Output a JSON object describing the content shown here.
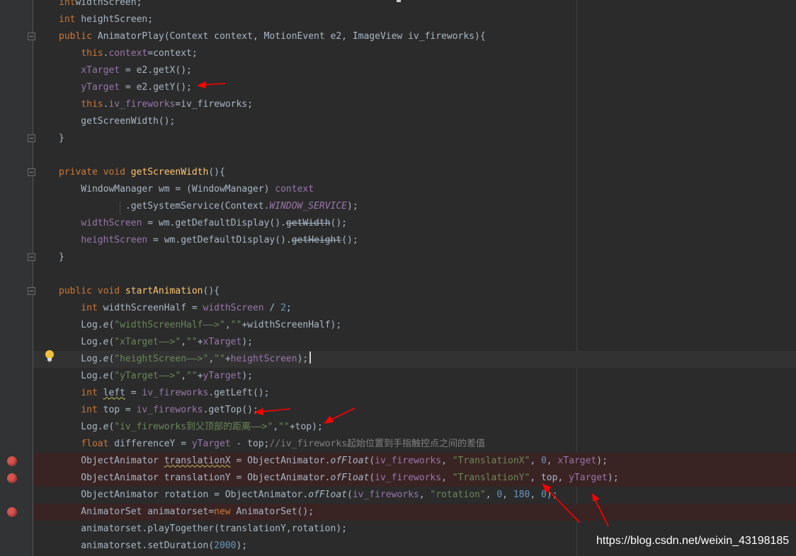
{
  "editor": {
    "lines": [
      {
        "id": "l1",
        "parts": [
          [
            "kw",
            "int"
          ],
          [
            "",
            "widthScreen;"
          ]
        ]
      },
      {
        "id": "l2",
        "parts": [
          [
            "kw",
            "int"
          ],
          [
            "",
            " heightScreen;"
          ]
        ]
      },
      {
        "id": "l3",
        "parts": [
          [
            "kw",
            "public"
          ],
          [
            "",
            " AnimatorPlay(Context context, MotionEvent e2, ImageView iv_fireworks){"
          ]
        ]
      },
      {
        "id": "l4",
        "parts": [
          [
            "",
            "    "
          ],
          [
            "kw",
            "this"
          ],
          [
            "",
            "."
          ],
          [
            "fld",
            "context"
          ],
          [
            "",
            "=context;"
          ]
        ]
      },
      {
        "id": "l5",
        "parts": [
          [
            "",
            "    "
          ],
          [
            "fld",
            "xTarget"
          ],
          [
            "",
            " = e2.getX();"
          ]
        ]
      },
      {
        "id": "l6",
        "parts": [
          [
            "",
            "    "
          ],
          [
            "fld",
            "yTarget"
          ],
          [
            "",
            " = e2.getY();"
          ]
        ]
      },
      {
        "id": "l7",
        "parts": [
          [
            "",
            "    "
          ],
          [
            "kw",
            "this"
          ],
          [
            "",
            "."
          ],
          [
            "fld",
            "iv_fireworks"
          ],
          [
            "",
            "=iv_fireworks;"
          ]
        ]
      },
      {
        "id": "l8",
        "parts": [
          [
            "",
            "    getScreenWidth();"
          ]
        ]
      },
      {
        "id": "l9",
        "parts": [
          [
            "",
            "}"
          ]
        ]
      },
      {
        "id": "l10",
        "parts": [
          [
            "kw",
            "private void"
          ],
          [
            "",
            " "
          ],
          [
            "fn",
            "getScreenWidth"
          ],
          [
            "",
            "(){"
          ]
        ]
      },
      {
        "id": "l11",
        "parts": [
          [
            "",
            "    WindowManager wm = (WindowManager) "
          ],
          [
            "fld",
            "context"
          ]
        ]
      },
      {
        "id": "l12",
        "parts": [
          [
            "",
            "            .getSystemService(Context."
          ],
          [
            "fld sm",
            "WINDOW_SERVICE"
          ],
          [
            "",
            ");"
          ]
        ]
      },
      {
        "id": "l13",
        "parts": [
          [
            "",
            "    "
          ],
          [
            "fld",
            "widthScreen"
          ],
          [
            "",
            " = wm.getDefaultDisplay()."
          ],
          [
            "strike",
            "getWidth"
          ],
          [
            "",
            "();"
          ]
        ]
      },
      {
        "id": "l14",
        "parts": [
          [
            "",
            "    "
          ],
          [
            "fld",
            "heightScreen"
          ],
          [
            "",
            " = wm.getDefaultDisplay()."
          ],
          [
            "strike",
            "getHeight"
          ],
          [
            "",
            "();"
          ]
        ]
      },
      {
        "id": "l15",
        "parts": [
          [
            "",
            "}"
          ]
        ]
      },
      {
        "id": "l16",
        "parts": [
          [
            "kw",
            "public void"
          ],
          [
            "",
            " "
          ],
          [
            "fn",
            "startAnimation"
          ],
          [
            "",
            "(){"
          ]
        ]
      },
      {
        "id": "l17",
        "parts": [
          [
            "",
            "    "
          ],
          [
            "kw",
            "int"
          ],
          [
            "",
            " widthScreenHalf = "
          ],
          [
            "fld",
            "widthScreen"
          ],
          [
            "",
            " / "
          ],
          [
            "num",
            "2"
          ],
          [
            "",
            ";"
          ]
        ]
      },
      {
        "id": "l18",
        "parts": [
          [
            "",
            "    Log."
          ],
          [
            "sm",
            "e"
          ],
          [
            "",
            "("
          ],
          [
            "str",
            "\"widthScreenHalf——>\""
          ],
          [
            "",
            ","
          ],
          [
            "str",
            "\"\""
          ],
          [
            "",
            "+widthScreenHalf);"
          ]
        ]
      },
      {
        "id": "l19",
        "parts": [
          [
            "",
            "    Log."
          ],
          [
            "sm",
            "e"
          ],
          [
            "",
            "("
          ],
          [
            "str",
            "\"xTarget——>\""
          ],
          [
            "",
            ","
          ],
          [
            "str",
            "\"\""
          ],
          [
            "",
            "+"
          ],
          [
            "fld",
            "xTarget"
          ],
          [
            "",
            ");"
          ]
        ]
      },
      {
        "id": "l20",
        "parts": [
          [
            "",
            "    Log."
          ],
          [
            "sm",
            "e"
          ],
          [
            "",
            "("
          ],
          [
            "str",
            "\"heightScreen——>\""
          ],
          [
            "",
            ","
          ],
          [
            "str",
            "\"\""
          ],
          [
            "",
            "+"
          ],
          [
            "fld",
            "heightScreen"
          ],
          [
            "",
            ");"
          ]
        ]
      },
      {
        "id": "l21",
        "parts": [
          [
            "",
            "    Log."
          ],
          [
            "sm",
            "e"
          ],
          [
            "",
            "("
          ],
          [
            "str",
            "\"yTarget——>\""
          ],
          [
            "",
            ","
          ],
          [
            "str",
            "\"\""
          ],
          [
            "",
            "+"
          ],
          [
            "fld",
            "yTarget"
          ],
          [
            "",
            ");"
          ]
        ]
      },
      {
        "id": "l22",
        "parts": [
          [
            "",
            "    "
          ],
          [
            "kw",
            "int"
          ],
          [
            "",
            " "
          ],
          [
            "warn",
            "left"
          ],
          [
            "",
            " = "
          ],
          [
            "fld",
            "iv_fireworks"
          ],
          [
            "",
            ".getLeft();"
          ]
        ]
      },
      {
        "id": "l23",
        "parts": [
          [
            "",
            "    "
          ],
          [
            "kw",
            "int"
          ],
          [
            "",
            " top = "
          ],
          [
            "fld",
            "iv_fireworks"
          ],
          [
            "",
            ".getTop();"
          ]
        ]
      },
      {
        "id": "l24",
        "parts": [
          [
            "",
            "    Log."
          ],
          [
            "sm",
            "e"
          ],
          [
            "",
            "("
          ],
          [
            "str",
            "\"iv_fireworks到父顶部的距离——>\""
          ],
          [
            "",
            ","
          ],
          [
            "str",
            "\"\""
          ],
          [
            "",
            "+top);"
          ]
        ]
      },
      {
        "id": "l25",
        "parts": [
          [
            "",
            "    "
          ],
          [
            "kw",
            "float"
          ],
          [
            "",
            " differenceY = "
          ],
          [
            "fld",
            "yTarget"
          ],
          [
            "",
            " - top;"
          ],
          [
            "cmt",
            "//iv_fireworks起始位置到手指触控点之间的差值"
          ]
        ]
      },
      {
        "id": "l26",
        "parts": [
          [
            "",
            "    ObjectAnimator "
          ],
          [
            "warn",
            "translationX"
          ],
          [
            "",
            " = ObjectAnimator."
          ],
          [
            "sm",
            "ofFloat"
          ],
          [
            "",
            "("
          ],
          [
            "fld",
            "iv_fireworks"
          ],
          [
            "",
            ", "
          ],
          [
            "str",
            "\"TranslationX\""
          ],
          [
            "",
            ", "
          ],
          [
            "num",
            "0"
          ],
          [
            "",
            ", "
          ],
          [
            "fld",
            "xTarget"
          ],
          [
            "",
            ");"
          ]
        ]
      },
      {
        "id": "l27",
        "parts": [
          [
            "",
            "    ObjectAnimator translationY = ObjectAnimator."
          ],
          [
            "sm",
            "ofFloat"
          ],
          [
            "",
            "("
          ],
          [
            "fld",
            "iv_fireworks"
          ],
          [
            "",
            ", "
          ],
          [
            "str",
            "\"TranslationY\""
          ],
          [
            "",
            ", top, "
          ],
          [
            "fld",
            "yTarget"
          ],
          [
            "",
            ");"
          ]
        ]
      },
      {
        "id": "l28",
        "parts": [
          [
            "",
            "    ObjectAnimator rotation = ObjectAnimator."
          ],
          [
            "sm",
            "ofFloat"
          ],
          [
            "",
            "("
          ],
          [
            "fld",
            "iv_fireworks"
          ],
          [
            "",
            ", "
          ],
          [
            "str",
            "\"rotation\""
          ],
          [
            "",
            ", "
          ],
          [
            "num",
            "0"
          ],
          [
            "",
            ", "
          ],
          [
            "num",
            "180"
          ],
          [
            "",
            ", "
          ],
          [
            "num",
            "0"
          ],
          [
            "",
            ");"
          ]
        ]
      },
      {
        "id": "l29",
        "parts": [
          [
            "",
            "    AnimatorSet animatorset="
          ],
          [
            "kw",
            "new"
          ],
          [
            "",
            " AnimatorSet();"
          ]
        ]
      },
      {
        "id": "l30",
        "parts": [
          [
            "",
            "    animatorset.playTogether(translationY,rotation);"
          ]
        ]
      },
      {
        "id": "l31",
        "parts": [
          [
            "",
            "    animatorset.setDuration("
          ],
          [
            "num",
            "2000"
          ],
          [
            "",
            ");"
          ]
        ]
      }
    ]
  },
  "watermark": "https://blog.csdn.net/weixin_43198185",
  "colors": {
    "background": "#2b2b2b",
    "keyword": "#cc7832",
    "field": "#9876aa",
    "string": "#6a8759",
    "number": "#6897bb",
    "method_decl": "#ffc66d",
    "breakpoint": "#d9534f",
    "annotation_arrow": "#ff0000"
  },
  "icons": [
    "fold-marker-icon",
    "breakpoint-icon",
    "lightbulb-icon",
    "red-arrow-annotation"
  ]
}
